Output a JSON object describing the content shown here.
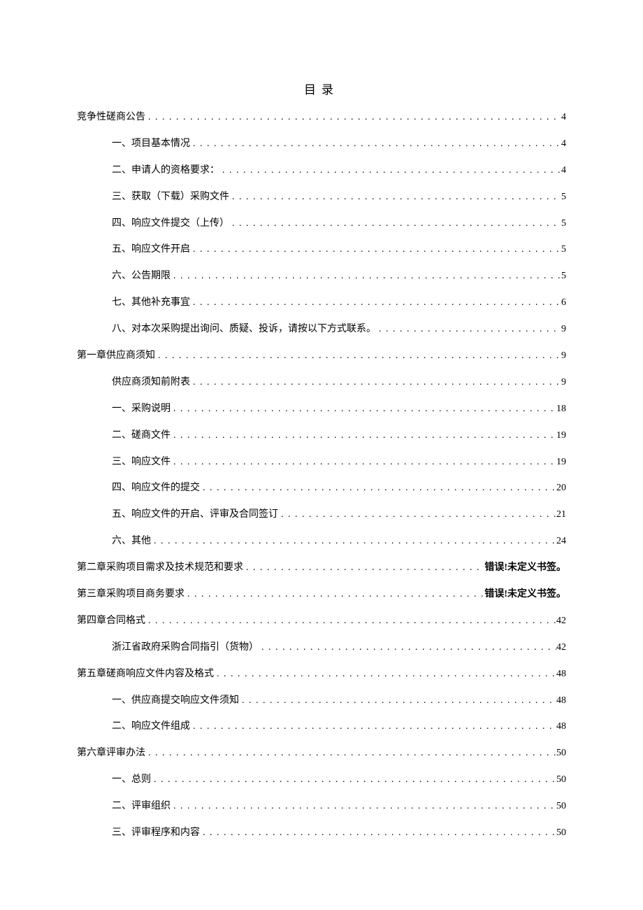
{
  "title": "目录",
  "error_text": "错误!未定义书签。",
  "entries": [
    {
      "level": 0,
      "label": "竞争性磋商公告",
      "page": "4"
    },
    {
      "level": 1,
      "label": "一、项目基本情况",
      "page": "4"
    },
    {
      "level": 1,
      "label": "二、申请人的资格要求：",
      "page": "4"
    },
    {
      "level": 1,
      "label": "三、获取（下载）采购文件",
      "page": "5"
    },
    {
      "level": 1,
      "label": "四、响应文件提交（上传）",
      "page": "5"
    },
    {
      "level": 1,
      "label": "五、响应文件开启",
      "page": "5"
    },
    {
      "level": 1,
      "label": "六、公告期限",
      "page": "5"
    },
    {
      "level": 1,
      "label": "七、其他补充事宜",
      "page": "6"
    },
    {
      "level": 1,
      "label": "八、对本次采购提出询问、质疑、投诉，请按以下方式联系。",
      "page": "9"
    },
    {
      "level": 0,
      "label": "第一章供应商须知",
      "page": "9"
    },
    {
      "level": 1,
      "label": "供应商须知前附表",
      "page": "9"
    },
    {
      "level": 1,
      "label": "一、采购说明",
      "page": "18"
    },
    {
      "level": 1,
      "label": "二、磋商文件",
      "page": "19"
    },
    {
      "level": 1,
      "label": "三、响应文件",
      "page": "19"
    },
    {
      "level": 1,
      "label": "四、响应文件的提交",
      "page": "20"
    },
    {
      "level": 1,
      "label": "五、响应文件的开启、评审及合同签订",
      "page": "21"
    },
    {
      "level": 1,
      "label": "六、其他",
      "page": "24"
    },
    {
      "level": 0,
      "label": "第二章采购项目需求及技术规范和要求",
      "page_error": true
    },
    {
      "level": 0,
      "label": "第三章采购项目商务要求",
      "page_error": true
    },
    {
      "level": 0,
      "label": "第四章合同格式",
      "page": "42"
    },
    {
      "level": 1,
      "label": "浙江省政府采购合同指引（货物）",
      "page": "42"
    },
    {
      "level": 0,
      "label": "第五章磋商响应文件内容及格式",
      "page": "48"
    },
    {
      "level": 1,
      "label": "一、供应商提交响应文件须知",
      "page": "48"
    },
    {
      "level": 1,
      "label": "二、响应文件组成",
      "page": "48"
    },
    {
      "level": 0,
      "label": "第六章评审办法",
      "page": "50"
    },
    {
      "level": 1,
      "label": "一、总则",
      "page": "50"
    },
    {
      "level": 1,
      "label": "二、评审组织",
      "page": "50"
    },
    {
      "level": 1,
      "label": "三、评审程序和内容",
      "page": "50"
    }
  ]
}
